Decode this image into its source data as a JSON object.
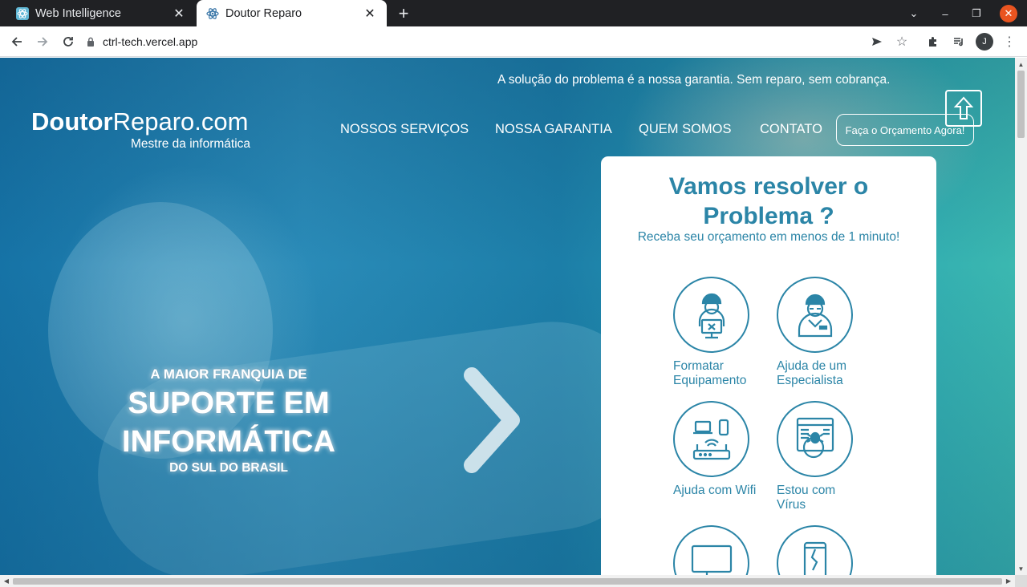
{
  "browser": {
    "tabs": [
      {
        "title": "Web Intelligence",
        "icon": "react-icon"
      },
      {
        "title": "Doutor Reparo",
        "icon": "react-icon"
      }
    ],
    "address": "ctrl-tech.vercel.app",
    "profile_initial": "J"
  },
  "site": {
    "tagline": "A solução do problema é a nossa garantia. Sem reparo, sem cobrança.",
    "logo_bold": "Doutor",
    "logo_rest": "Reparo.com",
    "logo_sub": "Mestre da informática",
    "nav": [
      "NOSSOS SERVIÇOS",
      "NOSSA GARANTIA",
      "QUEM SOMOS",
      "CONTATO"
    ],
    "cta": "Faça o Orçamento Agora!",
    "hero": {
      "line1": "A MAIOR FRANQUIA DE",
      "line2a": "SUPORTE EM",
      "line2b": "INFORMÁTICA",
      "line3": "DO SUL DO BRASIL"
    },
    "card": {
      "title_line1": "Vamos resolver o",
      "title_line2": "Problema ?",
      "subtitle": "Receba seu orçamento em menos de 1 minuto!",
      "services": [
        {
          "label_line1": "Formatar",
          "label_line2": "Equipamento",
          "icon": "technician-icon"
        },
        {
          "label_line1": "Ajuda de um",
          "label_line2": "Especialista",
          "icon": "specialist-icon"
        },
        {
          "label_line1": "Ajuda com Wifi",
          "label_line2": "",
          "icon": "wifi-router-icon"
        },
        {
          "label_line1": "Estou com",
          "label_line2": "Vírus",
          "icon": "virus-icon"
        },
        {
          "label_line1": "",
          "label_line2": "",
          "icon": "monitor-icon"
        },
        {
          "label_line1": "",
          "label_line2": "",
          "icon": "broken-phone-icon"
        }
      ]
    }
  },
  "colors": {
    "accent": "#2b85a7",
    "tabbar": "#202124",
    "close_button": "#e95420"
  }
}
